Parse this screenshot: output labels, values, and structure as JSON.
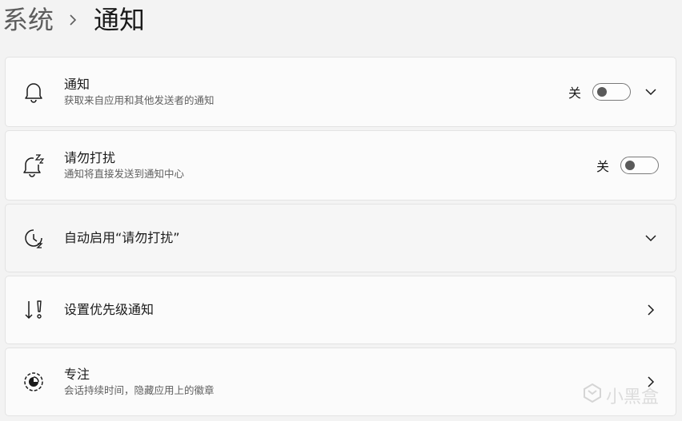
{
  "breadcrumb": {
    "parent": "系统",
    "current": "通知"
  },
  "cards": {
    "notifications": {
      "title": "通知",
      "subtitle": "获取来自应用和其他发送者的通知",
      "state": "关",
      "icon": "bell-icon"
    },
    "dnd": {
      "title": "请勿打扰",
      "subtitle": "通知将直接发送到通知中心",
      "state": "关",
      "icon": "bell-snooze-icon"
    },
    "auto_dnd": {
      "title": "自动启用“请勿打扰”",
      "icon": "clock-icon"
    },
    "priority": {
      "title": "设置优先级通知",
      "icon": "priority-icon"
    },
    "focus": {
      "title": "专注",
      "subtitle": "会话持续时间，隐藏应用上的徽章",
      "icon": "focus-icon"
    }
  },
  "watermark": "小黑盒",
  "colors": {
    "background": "#f3f3f3",
    "card": "#fbfbfb",
    "toggle_off": "#5a5a5a"
  }
}
